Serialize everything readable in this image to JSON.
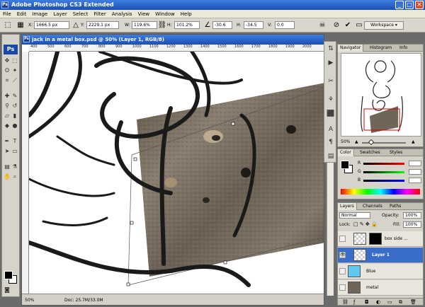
{
  "app": {
    "title": "Adobe Photoshop CS3 Extended",
    "logo": "Ps",
    "mini_logo": "Ps"
  },
  "window_buttons": {
    "minimize": "_",
    "maximize": "□",
    "close": "✕"
  },
  "menu": [
    "File",
    "Edit",
    "Image",
    "Layer",
    "Select",
    "Filter",
    "Analysis",
    "View",
    "Window",
    "Help"
  ],
  "options": {
    "x_label": "X:",
    "x_value": "1666.5 px",
    "y_label": "Y:",
    "y_value": "2229.1 px",
    "w_label": "W:",
    "w_value": "119.6%",
    "h_label": "H:",
    "h_value": "101.2%",
    "angle_value": "-30.6",
    "hskew_label": "H:",
    "hskew_value": "-34.5",
    "vskew_label": "V:",
    "vskew_value": "0.0",
    "workspace_label": "Workspace ▾"
  },
  "document": {
    "title": "jack in a metal box.psd @ 50% (Layer 1, RGB/8)",
    "ruler_ticks": [
      "400",
      "500",
      "600",
      "700",
      "800",
      "900",
      "1000",
      "1100",
      "1200",
      "1300",
      "1400",
      "1500",
      "1600",
      "1700",
      "1800",
      "1900",
      "2000"
    ],
    "zoom": "50%",
    "doc_size": "Doc: 25.7M/33.0M"
  },
  "navigator": {
    "tabs": [
      "Navigator",
      "Histogram",
      "Info"
    ],
    "zoom": "50%"
  },
  "color_panel": {
    "tabs": [
      "Color",
      "Swatches",
      "Styles"
    ],
    "channels": [
      {
        "label": "R",
        "value": ""
      },
      {
        "label": "G",
        "value": ""
      },
      {
        "label": "B",
        "value": ""
      }
    ]
  },
  "layers_panel": {
    "tabs": [
      "Layers",
      "Channels",
      "Paths"
    ],
    "blend_mode": "Normal",
    "opacity_label": "Opacity:",
    "opacity_value": "100%",
    "lock_label": "Lock:",
    "fill_label": "Fill:",
    "fill_value": "100%",
    "layers": [
      {
        "name": "box side ...",
        "visible": false,
        "selected": false
      },
      {
        "name": "Layer 1",
        "visible": true,
        "selected": true
      },
      {
        "name": "Blue",
        "visible": false,
        "selected": false
      },
      {
        "name": "metal",
        "visible": false,
        "selected": false
      }
    ]
  },
  "colors": {
    "title_blue": "#1c4fb0",
    "selected_layer": "#3a6cc9",
    "blue_layer": "#5ec8ee",
    "metal_brown": "#6f6558"
  }
}
